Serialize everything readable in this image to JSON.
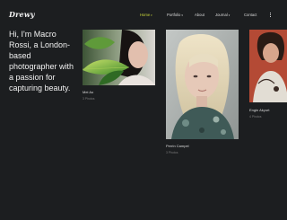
{
  "brand": {
    "logo": "Drewy"
  },
  "nav": {
    "items": [
      {
        "label": "Home",
        "active": true,
        "has_dropdown": true
      },
      {
        "label": "Portfolio",
        "active": false,
        "has_dropdown": true
      },
      {
        "label": "About",
        "active": false,
        "has_dropdown": false
      },
      {
        "label": "Journal",
        "active": false,
        "has_dropdown": true
      },
      {
        "label": "Contact",
        "active": false,
        "has_dropdown": false
      }
    ],
    "dropdown_glyph": "▾",
    "accent_color": "#c9d63a"
  },
  "hero": {
    "intro": "Hi, I'm Macro Rossi, a London-based photographer with a passion for capturing beauty."
  },
  "gallery": {
    "items": [
      {
        "title": "Mei Ao",
        "count": "3 Photos"
      },
      {
        "title": "Perrin Campel",
        "count": "3 Photos"
      },
      {
        "title": "Engin Akyurt",
        "count": "4 Photos"
      }
    ]
  },
  "icons": {
    "menu": "vertical-dots-icon",
    "dropdown": "chevron-down-icon"
  }
}
